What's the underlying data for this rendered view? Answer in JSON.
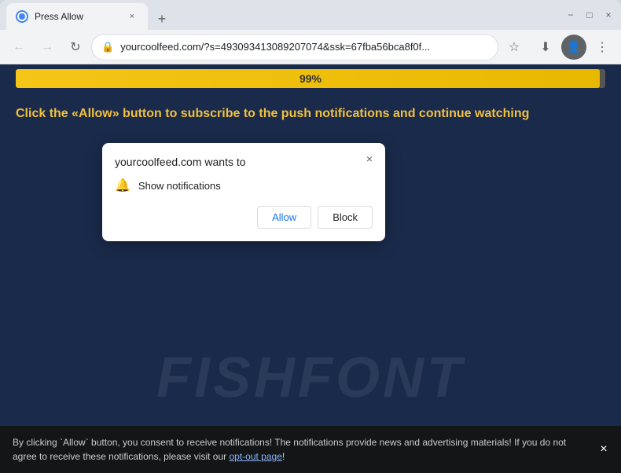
{
  "browser": {
    "title_bar": {
      "tab_title": "Press Allow",
      "tab_close_label": "×",
      "new_tab_label": "+",
      "minimize_label": "−",
      "maximize_label": "□",
      "close_label": "×"
    },
    "toolbar": {
      "back_label": "←",
      "forward_label": "→",
      "reload_label": "↻",
      "address": "yourcoolfeed.com/?s=493093413089207074&ssk=67fba56bca8f0f...",
      "star_label": "☆",
      "account_label": "👤",
      "menu_label": "⋮",
      "download_icon": "⬇"
    }
  },
  "page": {
    "progress_percent": "99%",
    "progress_width": "99",
    "cta_text": "Click the «Allow» button to subscribe to the push notifications and continue watching",
    "watermark_text": "FISHFONT",
    "background_color": "#1a2a4a"
  },
  "popup": {
    "title": "yourcoolfeed.com wants to",
    "close_label": "×",
    "notification_label": "Show notifications",
    "allow_label": "Allow",
    "block_label": "Block"
  },
  "banner": {
    "text_part1": "By clicking `Allow` button, you consent to receive notifications! The notifications provide news and advertising materials! If you do not agree to receive these notifications, please visit our ",
    "opt_out_label": "opt-out page",
    "text_part2": "!",
    "close_label": "×"
  }
}
